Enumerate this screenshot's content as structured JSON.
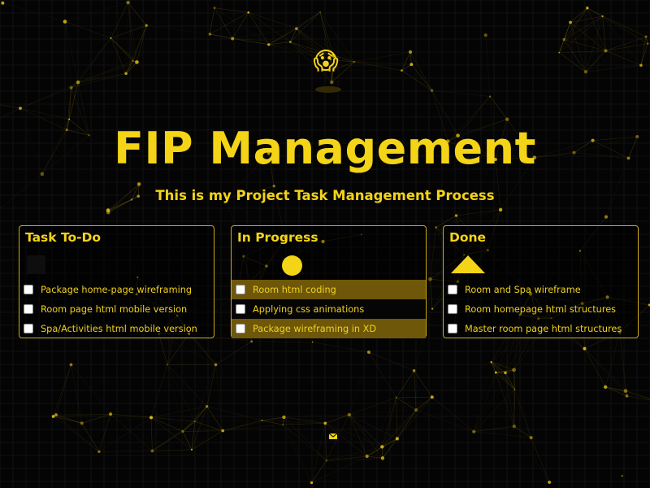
{
  "header": {
    "mascot_icon": "ghost-face-icon",
    "mascot_glyph": "😱",
    "title": "FIP Management",
    "subtitle": "This is my Project Task Management Process"
  },
  "colors": {
    "accent": "#f4d416",
    "background": "#040404",
    "highlight_row": "#6e5708"
  },
  "columns": [
    {
      "title": "Task To-Do",
      "shape": "square",
      "tasks": [
        {
          "label": "Package home-page wireframing",
          "checked": false
        },
        {
          "label": "Room page html mobile version",
          "checked": false
        },
        {
          "label": "Spa/Activities html mobile version",
          "checked": false
        }
      ]
    },
    {
      "title": "In Progress",
      "shape": "circle",
      "tasks": [
        {
          "label": "Room html coding",
          "checked": false,
          "highlighted": true
        },
        {
          "label": "Applying css animations",
          "checked": false,
          "highlighted": false
        },
        {
          "label": "Package wireframing in XD",
          "checked": false,
          "highlighted": true
        }
      ]
    },
    {
      "title": "Done",
      "shape": "triangle",
      "tasks": [
        {
          "label": "Room and Spa wireframe",
          "checked": false
        },
        {
          "label": "Room homepage html structures",
          "checked": false
        },
        {
          "label": "Master room page html structures",
          "checked": false
        }
      ]
    }
  ],
  "footer": {
    "contact_icon": "mail-icon"
  }
}
